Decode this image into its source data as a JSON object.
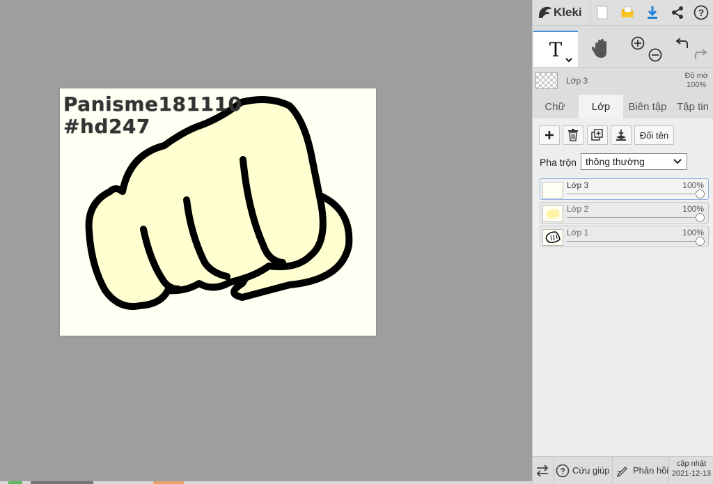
{
  "app": {
    "name": "Kleki"
  },
  "canvas": {
    "text_line1": "Panisme181110",
    "text_line2": "#hd247",
    "background_color": "#fffff4",
    "fill_color": "#ffffd2",
    "stroke_color": "#000000"
  },
  "topbar": {
    "icons": [
      "kleki-logo-icon",
      "new-file-icon",
      "open-folder-icon",
      "download-icon",
      "share-icon",
      "help-icon"
    ],
    "download_color": "#1e7fd9",
    "folder_color": "#f2b705"
  },
  "tools": {
    "text_tool_label": "T",
    "items": [
      "text-tool",
      "hand-tool",
      "zoom-in",
      "zoom-out",
      "undo",
      "redo"
    ]
  },
  "current_layer": {
    "name": "Lớp 3",
    "opacity_label": "Độ mờ",
    "opacity_value": "100%"
  },
  "tabs": [
    {
      "label": "Chữ",
      "active": false
    },
    {
      "label": "Lớp",
      "active": true
    },
    {
      "label": "Biên tập",
      "active": false
    },
    {
      "label": "Tập tin",
      "active": false
    }
  ],
  "layer_panel": {
    "buttons": [
      "add-layer",
      "delete-layer",
      "duplicate-layer",
      "merge-down"
    ],
    "rename_label": "Đổi tên",
    "blend_label": "Pha trộn",
    "blend_value": "thông thường",
    "layers": [
      {
        "name": "Lớp 3",
        "opacity": "100%",
        "selected": true
      },
      {
        "name": "Lớp 2",
        "opacity": "100%",
        "selected": false
      },
      {
        "name": "Lớp 1",
        "opacity": "100%",
        "selected": false
      }
    ]
  },
  "bottombar": {
    "help_label": "Cứu giúp",
    "feedback_label": "Phản hồi",
    "update_label": "cập nhật",
    "update_date": "2021-12-13"
  }
}
